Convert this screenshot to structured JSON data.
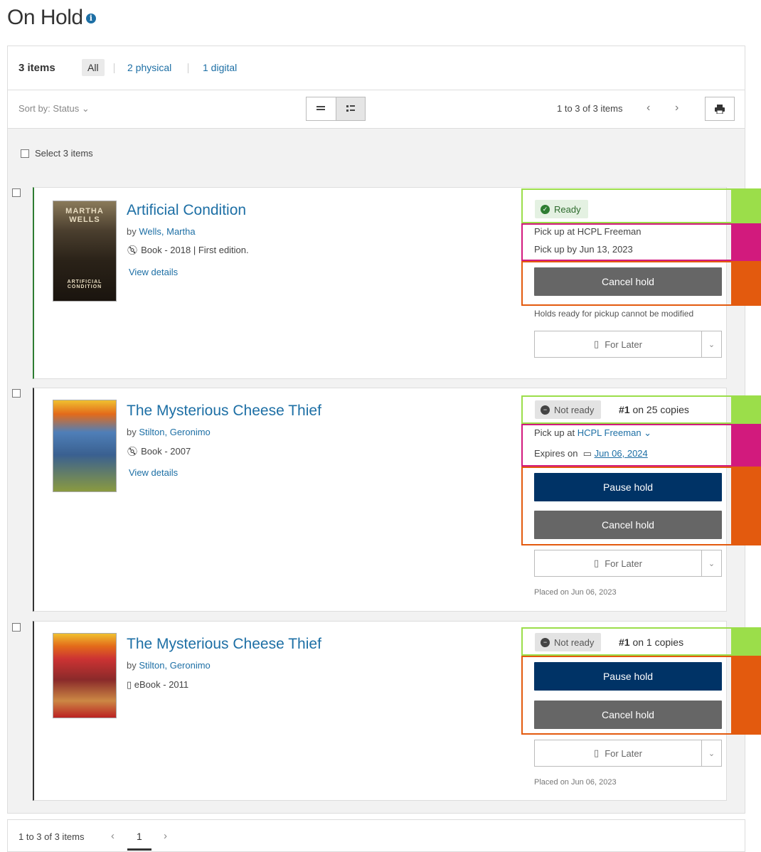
{
  "page": {
    "title": "On Hold",
    "info_icon": "i"
  },
  "tabs": {
    "count": "3 items",
    "all": "All",
    "physical": "2 physical",
    "digital": "1 digital"
  },
  "toolbar": {
    "sort": "Sort by: Status ⌄",
    "range": "1 to 3 of 3 items",
    "prev": "‹",
    "next": "›"
  },
  "select_all": "Select 3 items",
  "items": [
    {
      "title": "Artificial Condition",
      "by": "by",
      "author": "Wells, Martha",
      "format": "Book - 2018 | First edition.",
      "view_details": "View details",
      "cover_text": "MARTHA WELLS",
      "cover_sub": "ARTIFICIAL CONDITION",
      "status": "Ready",
      "pickup": "Pick up at HCPL Freeman",
      "pickup_by": "Pick up by Jun 13, 2023",
      "cancel": "Cancel hold",
      "note": "Holds ready for pickup cannot be modified",
      "for_later": "For Later"
    },
    {
      "title": "The Mysterious Cheese Thief",
      "by": "by",
      "author": "Stilton, Geronimo",
      "format": "Book - 2007",
      "view_details": "View details",
      "status": "Not ready",
      "queue_num": "#1",
      "queue_rest": "on 25 copies",
      "pickup": "Pick up at",
      "pickup_location": "HCPL Freeman ⌄",
      "expires_label": "Expires on",
      "expires_date": "Jun 06, 2024",
      "pause": "Pause hold",
      "cancel": "Cancel hold",
      "for_later": "For Later",
      "placed": "Placed on Jun 06, 2023"
    },
    {
      "title": "The Mysterious Cheese Thief",
      "by": "by",
      "author": "Stilton, Geronimo",
      "format": "eBook - 2011",
      "status": "Not ready",
      "queue_num": "#1",
      "queue_rest": "on 1 copies",
      "pause": "Pause hold",
      "cancel": "Cancel hold",
      "for_later": "For Later",
      "placed": "Placed on Jun 06, 2023"
    }
  ],
  "footer": {
    "range": "1 to 3 of 3 items",
    "prev": "‹",
    "page": "1",
    "next": "›"
  },
  "colors": {
    "link": "#1d6fa5",
    "navy_button": "#003366",
    "gray_button": "#666666",
    "highlight_green": "#9bde4a",
    "highlight_magenta": "#d21a7d",
    "highlight_orange": "#e35a0e"
  }
}
